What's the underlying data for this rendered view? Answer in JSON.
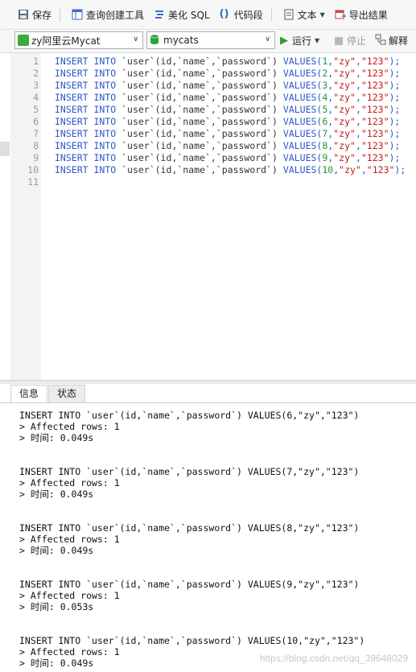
{
  "toolbar": {
    "save": "保存",
    "query_builder": "查询创建工具",
    "beautify": "美化 SQL",
    "snippet": "代码段",
    "text": "文本",
    "export": "导出结果"
  },
  "connection": {
    "server": "zy阿里云Mycat",
    "database": "mycats",
    "run": "运行",
    "stop": "停止",
    "explain": "解释"
  },
  "editor": {
    "lines": [
      {
        "n": "1",
        "kw1": "INSERT INTO ",
        "ident": "`user`(id,`name`,`password`) ",
        "kw2": "VALUES(",
        "val": "1",
        "a": ",",
        "s1": "\"zy\"",
        "b": ",",
        "s2": "\"123\"",
        "end": ");"
      },
      {
        "n": "2",
        "kw1": "INSERT INTO ",
        "ident": "`user`(id,`name`,`password`) ",
        "kw2": "VALUES(",
        "val": "2",
        "a": ",",
        "s1": "\"zy\"",
        "b": ",",
        "s2": "\"123\"",
        "end": ");"
      },
      {
        "n": "3",
        "kw1": "INSERT INTO ",
        "ident": "`user`(id,`name`,`password`) ",
        "kw2": "VALUES(",
        "val": "3",
        "a": ",",
        "s1": "\"zy\"",
        "b": ",",
        "s2": "\"123\"",
        "end": ");"
      },
      {
        "n": "4",
        "kw1": "INSERT INTO ",
        "ident": "`user`(id,`name`,`password`) ",
        "kw2": "VALUES(",
        "val": "4",
        "a": ",",
        "s1": "\"zy\"",
        "b": ",",
        "s2": "\"123\"",
        "end": ");"
      },
      {
        "n": "5",
        "kw1": "INSERT INTO ",
        "ident": "`user`(id,`name`,`password`) ",
        "kw2": "VALUES(",
        "val": "5",
        "a": ",",
        "s1": "\"zy\"",
        "b": ",",
        "s2": "\"123\"",
        "end": ");"
      },
      {
        "n": "6",
        "kw1": "INSERT INTO ",
        "ident": "`user`(id,`name`,`password`) ",
        "kw2": "VALUES(",
        "val": "6",
        "a": ",",
        "s1": "\"zy\"",
        "b": ",",
        "s2": "\"123\"",
        "end": ");"
      },
      {
        "n": "7",
        "kw1": "INSERT INTO ",
        "ident": "`user`(id,`name`,`password`) ",
        "kw2": "VALUES(",
        "val": "7",
        "a": ",",
        "s1": "\"zy\"",
        "b": ",",
        "s2": "\"123\"",
        "end": ");"
      },
      {
        "n": "8",
        "kw1": "INSERT INTO ",
        "ident": "`user`(id,`name`,`password`) ",
        "kw2": "VALUES(",
        "val": "8",
        "a": ",",
        "s1": "\"zy\"",
        "b": ",",
        "s2": "\"123\"",
        "end": ");"
      },
      {
        "n": "9",
        "kw1": "INSERT INTO ",
        "ident": "`user`(id,`name`,`password`) ",
        "kw2": "VALUES(",
        "val": "9",
        "a": ",",
        "s1": "\"zy\"",
        "b": ",",
        "s2": "\"123\"",
        "end": ");"
      },
      {
        "n": "10",
        "kw1": "INSERT INTO ",
        "ident": "`user`(id,`name`,`password`) ",
        "kw2": "VALUES(",
        "val": "10",
        "a": ",",
        "s1": "\"zy\"",
        "b": ",",
        "s2": "\"123\"",
        "end": ");"
      },
      {
        "n": "11",
        "kw1": "",
        "ident": "",
        "kw2": "",
        "val": "",
        "a": "",
        "s1": "",
        "b": "",
        "s2": "",
        "end": ""
      }
    ]
  },
  "tabs": [
    "信息",
    "状态"
  ],
  "messages": [
    {
      "sql": "INSERT INTO `user`(id,`name`,`password`) VALUES(6,\"zy\",\"123\")",
      "rows": "> Affected rows: 1",
      "time": "> 时间: 0.049s"
    },
    {
      "sql": "INSERT INTO `user`(id,`name`,`password`) VALUES(7,\"zy\",\"123\")",
      "rows": "> Affected rows: 1",
      "time": "> 时间: 0.049s"
    },
    {
      "sql": "INSERT INTO `user`(id,`name`,`password`) VALUES(8,\"zy\",\"123\")",
      "rows": "> Affected rows: 1",
      "time": "> 时间: 0.049s"
    },
    {
      "sql": "INSERT INTO `user`(id,`name`,`password`) VALUES(9,\"zy\",\"123\")",
      "rows": "> Affected rows: 1",
      "time": "> 时间: 0.053s"
    },
    {
      "sql": "INSERT INTO `user`(id,`name`,`password`) VALUES(10,\"zy\",\"123\")",
      "rows": "> Affected rows: 1",
      "time": "> 时间: 0.049s"
    }
  ],
  "watermark": "https://blog.csdn.net/qq_39648029",
  "colors": {
    "keyword": "#2d57c8",
    "number": "#1a9a3a",
    "string": "#c21a1a"
  }
}
